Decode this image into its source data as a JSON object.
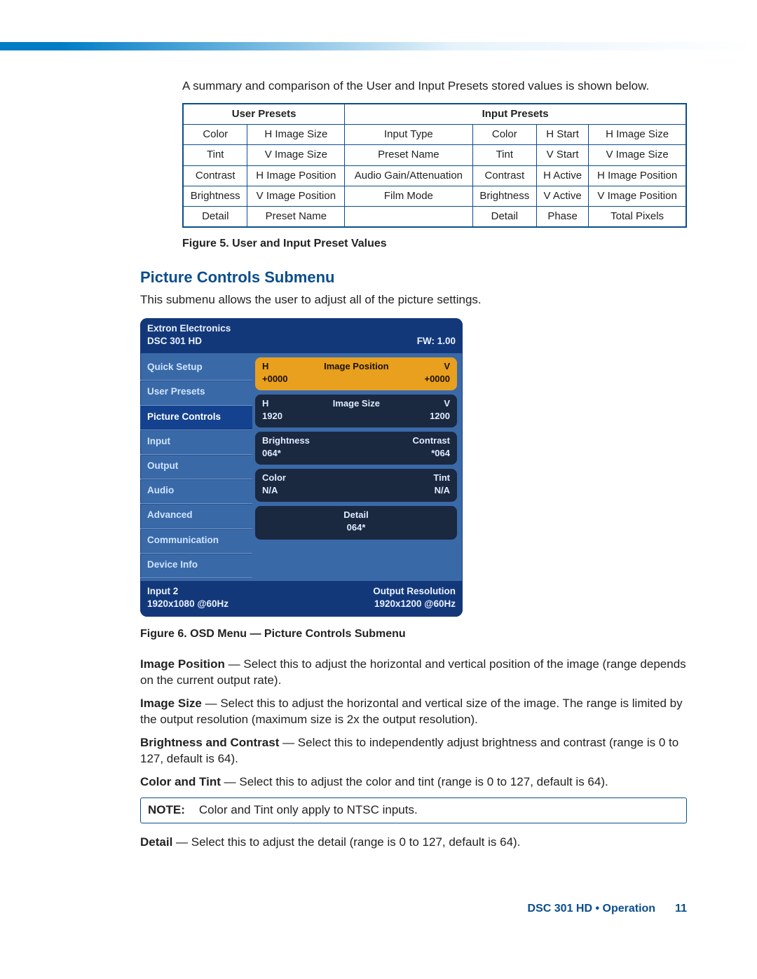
{
  "intro": "A summary and comparison of the User and Input Presets stored values is shown below.",
  "preset_table": {
    "headers": {
      "user": "User Presets",
      "input": "Input Presets"
    },
    "rows": [
      {
        "u1": "Color",
        "u2": "H Image Size",
        "i1": "Input Type",
        "i2": "Color",
        "i3": "H Start",
        "i4": "H Image Size"
      },
      {
        "u1": "Tint",
        "u2": "V Image Size",
        "i1": "Preset Name",
        "i2": "Tint",
        "i3": "V Start",
        "i4": "V Image Size"
      },
      {
        "u1": "Contrast",
        "u2": "H Image Position",
        "i1": "Audio Gain/Attenuation",
        "i2": "Contrast",
        "i3": "H Active",
        "i4": "H Image Position"
      },
      {
        "u1": "Brightness",
        "u2": "V Image Position",
        "i1": "Film Mode",
        "i2": "Brightness",
        "i3": "V Active",
        "i4": "V Image Position"
      },
      {
        "u1": "Detail",
        "u2": "Preset Name",
        "i1": "",
        "i2": "Detail",
        "i3": "Phase",
        "i4": "Total Pixels"
      }
    ]
  },
  "fig5": "Figure 5.   User and Input Preset Values",
  "section_title": "Picture Controls Submenu",
  "section_intro": "This submenu allows the user to adjust all of the picture settings.",
  "osd": {
    "brand": "Extron Electronics",
    "model": "DSC 301 HD",
    "fw": "FW: 1.00",
    "sidebar": [
      "Quick Setup",
      "User Presets",
      "Picture Controls",
      "Input",
      "Output",
      "Audio",
      "Advanced",
      "Communication",
      "Device Info"
    ],
    "active_index": 2,
    "fields": {
      "image_position": {
        "title": "Image Position",
        "h_label": "H",
        "v_label": "V",
        "h_val": "+0000",
        "v_val": "+0000"
      },
      "image_size": {
        "title": "Image Size",
        "h_label": "H",
        "v_label": "V",
        "h_val": "1920",
        "v_val": "1200"
      },
      "bright_cont": {
        "l_label": "Brightness",
        "l_val": "064*",
        "r_label": "Contrast",
        "r_val": "*064"
      },
      "color_tint": {
        "l_label": "Color",
        "l_val": "N/A",
        "r_label": "Tint",
        "r_val": "N/A"
      },
      "detail": {
        "label": "Detail",
        "val": "064*"
      }
    },
    "footer": {
      "in_label": "Input 2",
      "in_val": "1920x1080 @60Hz",
      "out_label": "Output Resolution",
      "out_val": "1920x1200 @60Hz"
    }
  },
  "fig6": "Figure 6.   OSD Menu — Picture Controls Submenu",
  "desc": {
    "img_pos": {
      "b": "Image Position",
      "t": " — Select this to adjust the horizontal and vertical position of the image (range depends on the current output rate)."
    },
    "img_size": {
      "b": "Image Size",
      "t": " — Select this to adjust the horizontal and vertical size of the image. The range is limited by the output resolution (maximum size is 2x the output resolution)."
    },
    "bc": {
      "b": "Brightness and Contrast",
      "t": " — Select this to independently adjust brightness and contrast (range is 0 to 127, default is 64)."
    },
    "ct": {
      "b": "Color and Tint",
      "t": " — Select this to adjust the color and tint (range is 0 to 127, default is 64)."
    },
    "detail": {
      "b": "Detail",
      "t": " — Select this to adjust the detail (range is 0 to 127, default is 64)."
    }
  },
  "note": {
    "label": "NOTE:",
    "text": "Color and Tint only apply to NTSC inputs."
  },
  "footer": {
    "text": "DSC 301 HD • Operation",
    "page": "11"
  }
}
